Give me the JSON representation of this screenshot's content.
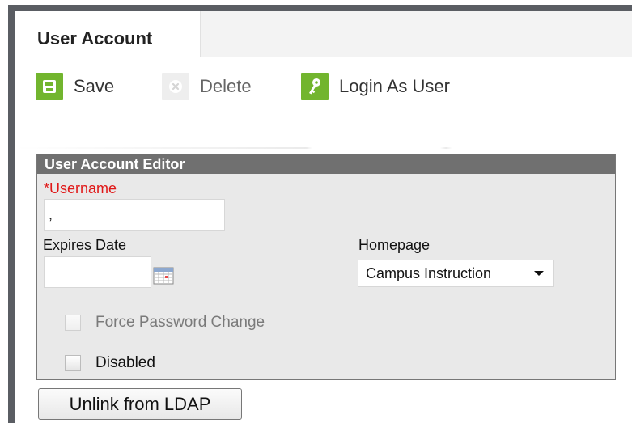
{
  "tabs": [
    {
      "label": "User Account",
      "active": true
    }
  ],
  "toolbar": {
    "save_label": "Save",
    "delete_label": "Delete",
    "login_as_user_label": "Login As User"
  },
  "editor": {
    "title": "User Account Editor",
    "username_label": "*Username",
    "username_value": ",",
    "expires_date_label": "Expires Date",
    "expires_date_value": "",
    "homepage_label": "Homepage",
    "homepage_selected": "Campus Instruction",
    "force_password_change_label": "Force Password Change",
    "force_password_change_checked": false,
    "force_password_change_enabled": false,
    "disabled_label": "Disabled",
    "disabled_checked": false
  },
  "actions": {
    "unlink_ldap_label": "Unlink from LDAP"
  },
  "icons": {
    "save": "save-icon",
    "delete": "delete-icon",
    "login_as_user": "key-icon",
    "calendar": "calendar-icon",
    "dropdown": "chevron-down-icon"
  },
  "colors": {
    "frame": "#5a5d63",
    "accent_green": "#72b52e",
    "editor_header": "#707070",
    "required": "#e01818"
  }
}
